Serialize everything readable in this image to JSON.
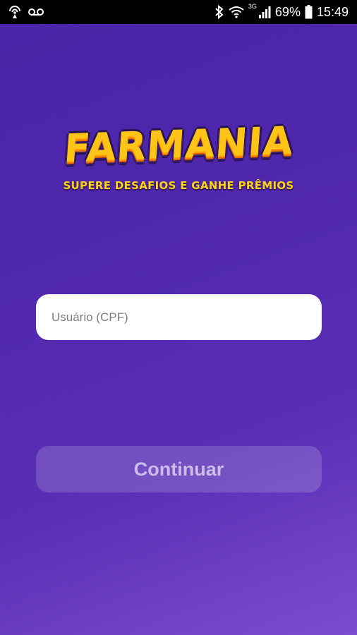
{
  "status_bar": {
    "battery_percent": "69%",
    "time": "15:49",
    "network_type": "3G",
    "icons": [
      "hotspot-icon",
      "voicemail-icon",
      "bluetooth-icon",
      "wifi-icon",
      "signal-icon",
      "battery-icon"
    ]
  },
  "logo": {
    "title": "FARMANIA",
    "subtitle": "SUPERE DESAFIOS E GANHE PRÊMIOS"
  },
  "login": {
    "cpf_placeholder": "Usuário (CPF)",
    "cpf_value": "",
    "continue_label": "Continuar"
  },
  "colors": {
    "background": "#4f27ad",
    "logo_yellow": "#ffc418",
    "input_bg": "#ffffff"
  }
}
